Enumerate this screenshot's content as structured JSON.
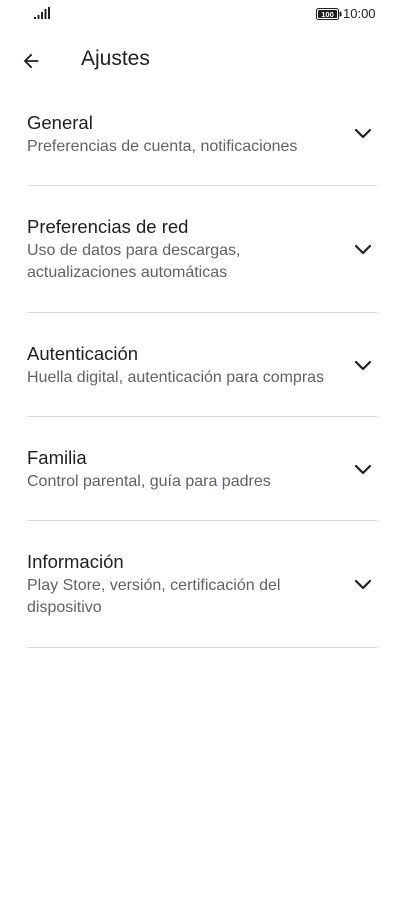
{
  "status_bar": {
    "time": "10:00",
    "battery": "100",
    "signal_icon": "signal-bars-icon"
  },
  "app_bar": {
    "back_icon": "arrow-left-icon",
    "title": "Ajustes"
  },
  "settings": [
    {
      "title": "General",
      "subtitle": "Preferencias de cuenta, notificaciones",
      "icon": "chevron-down-icon"
    },
    {
      "title": "Preferencias de red",
      "subtitle": "Uso de datos para descargas, actualizaciones automáticas",
      "icon": "chevron-down-icon"
    },
    {
      "title": "Autenticación",
      "subtitle": "Huella digital, autenticación para compras",
      "icon": "chevron-down-icon"
    },
    {
      "title": "Familia",
      "subtitle": "Control parental, guía para padres",
      "icon": "chevron-down-icon"
    },
    {
      "title": "Información",
      "subtitle": "Play Store, versión, certificación del dispositivo",
      "icon": "chevron-down-icon"
    }
  ],
  "colors": {
    "text_primary": "#202124",
    "text_secondary": "#5f6368",
    "divider": "#dadce0",
    "background": "#ffffff"
  }
}
